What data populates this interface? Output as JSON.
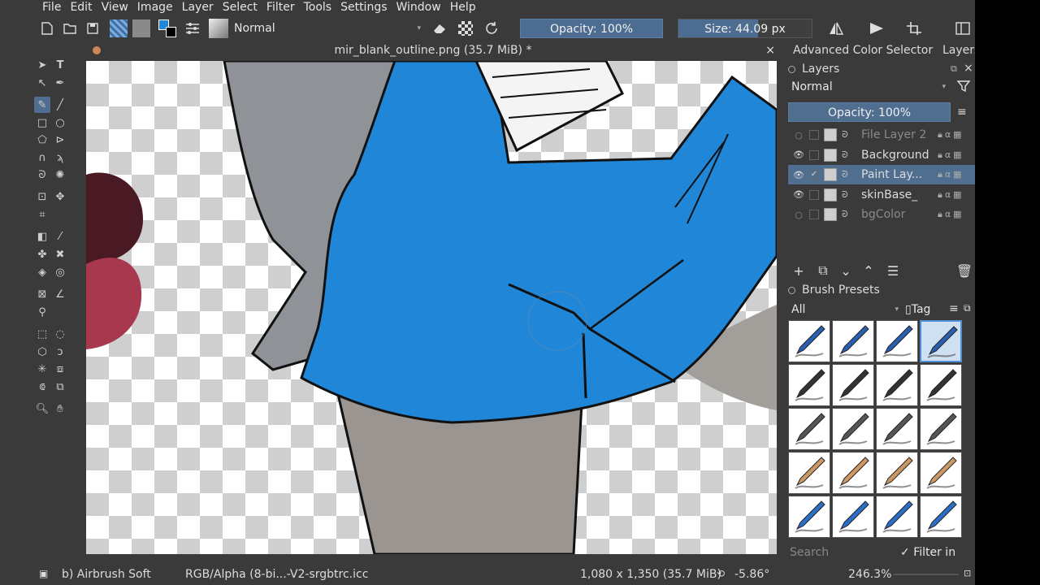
{
  "menu": [
    "File",
    "Edit",
    "View",
    "Image",
    "Layer",
    "Select",
    "Filter",
    "Tools",
    "Settings",
    "Window",
    "Help"
  ],
  "toolbar": {
    "blend_mode": "Normal",
    "opacity_label": "Opacity: 100%",
    "opacity_value": 1.0,
    "size_label": "Size: 44.09 px",
    "size_value": 0.6
  },
  "document": {
    "tab_title": "mir_blank_outline.png (35.7 MiB) *",
    "close_glyph": "×"
  },
  "dock": {
    "tabs": [
      "Advanced Color Selector",
      "Layers"
    ],
    "layers_title": "Layers",
    "blend_mode": "Normal",
    "opacity_label": "Opacity:  100%",
    "layers": [
      {
        "name": "File Layer 2",
        "visible": false,
        "selected": false
      },
      {
        "name": "Background",
        "visible": true,
        "selected": false
      },
      {
        "name": "Paint Lay...",
        "visible": true,
        "selected": true
      },
      {
        "name": "skinBase_",
        "visible": true,
        "selected": false
      },
      {
        "name": "bgColor",
        "visible": false,
        "selected": false
      }
    ],
    "brush_presets_title": "Brush Presets",
    "brush_filter": "All",
    "tag_label": "Tag",
    "search_placeholder": "Search",
    "filter_in_tag": "Filter in Tag"
  },
  "status": {
    "brush_name": "b) Airbrush Soft",
    "color_profile": "RGB/Alpha (8-bi...-V2-srgbtrc.icc",
    "image_size": "1,080 x 1,350 (35.7 MiB)",
    "rotation": "-5.86°",
    "zoom": "246.3%"
  },
  "colors": {
    "accent": "#4f6e90",
    "ui_bg": "#3a3a3a",
    "paint_blue": "#1f86d8",
    "skin_grey": "#9a9590",
    "hair_dark": "#4a1a24",
    "hair_pink": "#a8384e"
  }
}
